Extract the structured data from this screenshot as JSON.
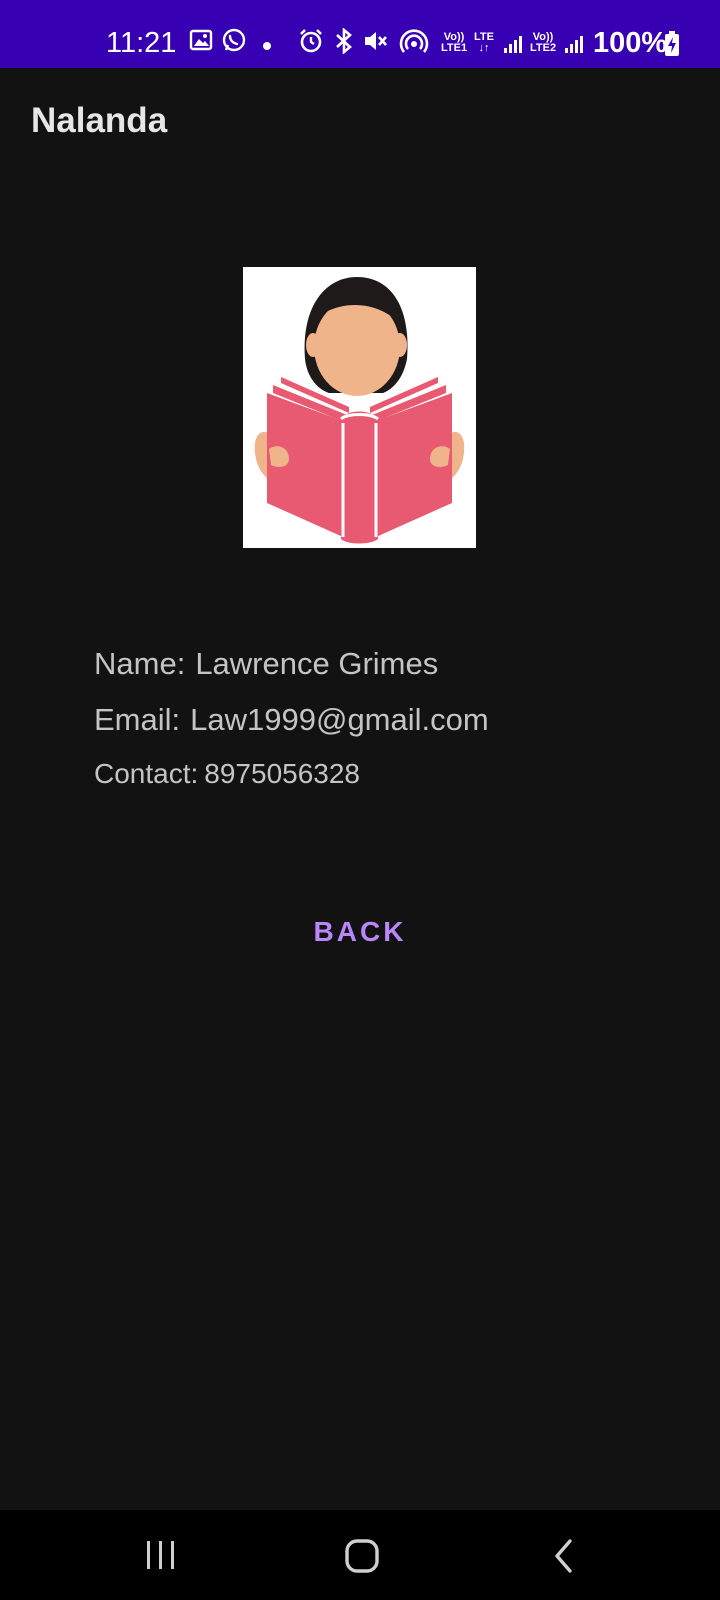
{
  "status_bar": {
    "time": "11:21",
    "battery_percent": "100%",
    "sim1_volte": "Vo))",
    "sim1_lte": "LTE1",
    "data_lte": "LTE",
    "sim2_volte": "Vo))",
    "sim2_lte": "LTE2",
    "icons": [
      "gallery-icon",
      "whatsapp-icon",
      "dot-icon",
      "alarm-icon",
      "bluetooth-icon",
      "mute-icon",
      "hotspot-icon",
      "signal-icon",
      "battery-charging-icon"
    ]
  },
  "app_bar": {
    "title": "Nalanda"
  },
  "profile": {
    "avatar_icon": "reader-avatar-icon",
    "name_label": "Name:",
    "name_value": "Lawrence Grimes",
    "email_label": "Email:",
    "email_value": "Law1999@gmail.com",
    "contact_label": "Contact:",
    "contact_value": "8975056328"
  },
  "actions": {
    "back_label": "BACK"
  },
  "colors": {
    "status_bar": "#3700b3",
    "background": "#121212",
    "accent": "#bb86fc",
    "book": "#e85a72",
    "skin": "#f0b48a"
  },
  "nav_bar": {
    "icons": [
      "recents-icon",
      "home-icon",
      "back-icon"
    ]
  }
}
